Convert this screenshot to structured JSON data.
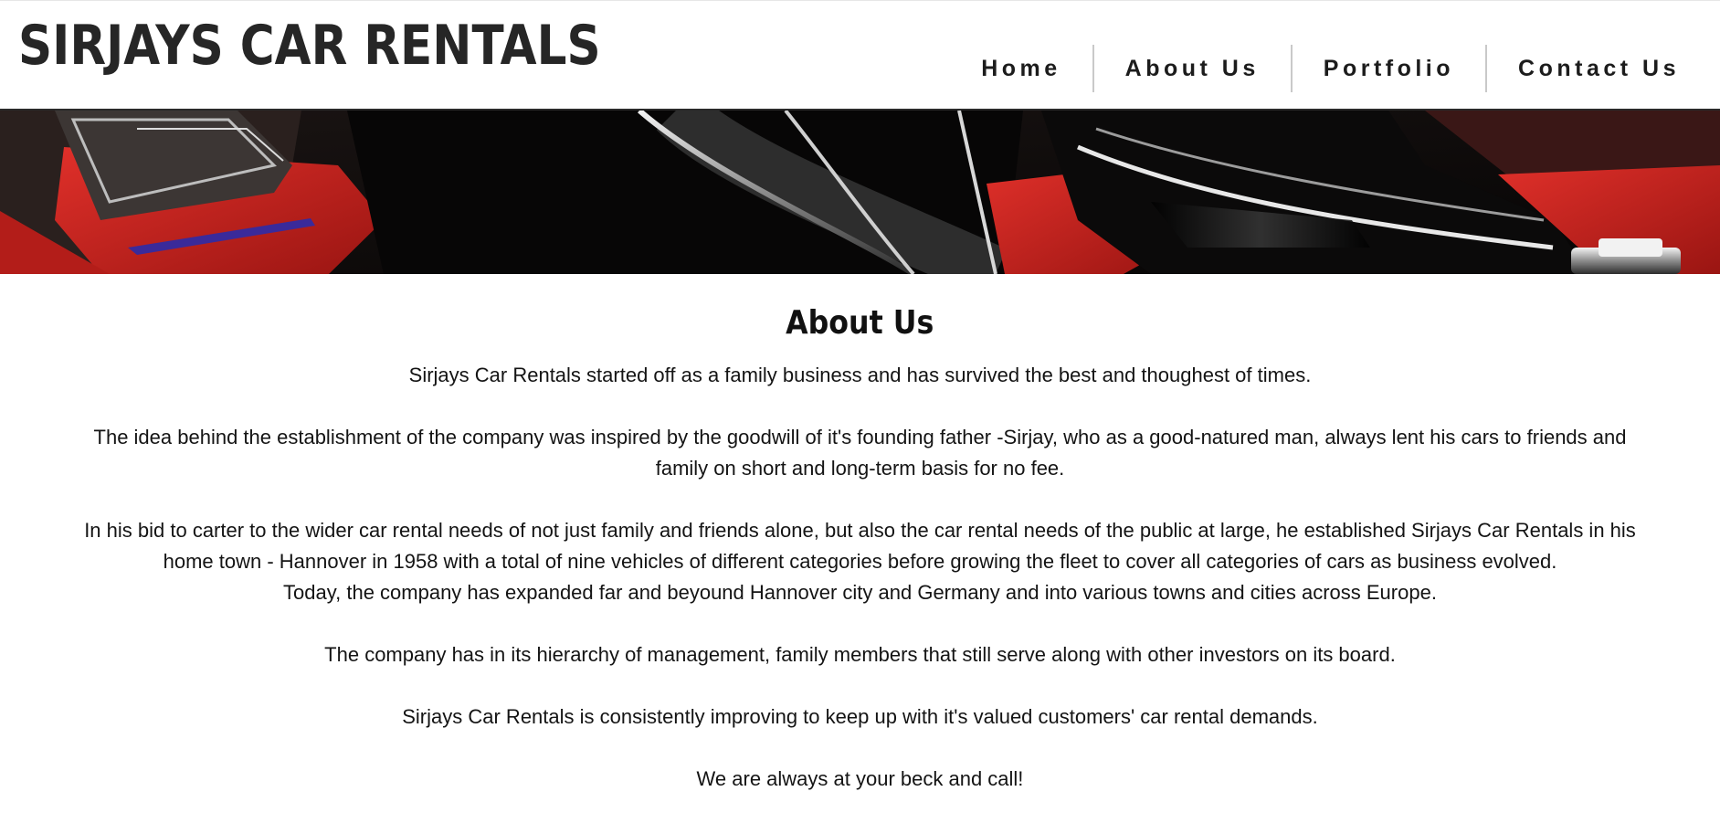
{
  "brand": {
    "title": "SIRJAYS CAR RENTALS"
  },
  "nav": {
    "items": [
      {
        "label": "Home"
      },
      {
        "label": "About Us"
      },
      {
        "label": "Portfolio"
      },
      {
        "label": "Contact Us"
      }
    ]
  },
  "banner": {
    "subject": "car-interior-photo"
  },
  "about": {
    "heading": "About Us",
    "paragraphs": [
      {
        "lines": [
          "Sirjays Car Rentals started off as a family business and has survived the best and thoughest of times."
        ]
      },
      {
        "lines": [
          "The idea behind the establishment of the company was inspired by the goodwill of it's founding father -Sirjay, who as a good-natured man, always lent his cars to friends and",
          "family on short and long-term basis for no fee."
        ]
      },
      {
        "lines": [
          "In his bid to carter to the wider car rental needs of not just family and friends alone, but also the car rental needs of the public at large, he established Sirjays Car Rentals in his",
          "home town - Hannover in 1958 with a total of nine vehicles of different categories before growing the fleet to cover all categories of cars as business evolved.",
          "Today, the company has expanded far and beyound Hannover city and Germany and into various towns and cities across Europe."
        ]
      },
      {
        "lines": [
          "The company has in its hierarchy of management, family members that still serve along with other investors on its board."
        ]
      },
      {
        "lines": [
          "Sirjays Car Rentals is consistently improving to keep up with it's valued customers' car rental demands."
        ]
      },
      {
        "lines": [
          "We are always at your beck and call!"
        ]
      }
    ]
  },
  "colors": {
    "brand_text": "#262626",
    "accent_red": "#c8201e",
    "header_rule": "#2a2a2a"
  }
}
